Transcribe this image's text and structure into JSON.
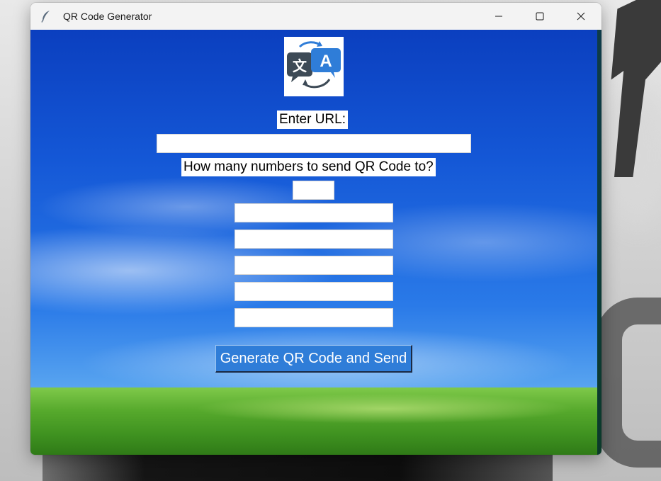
{
  "window": {
    "title": "QR Code Generator"
  },
  "icons": {
    "app": "feather-icon",
    "logo": "translate-icon",
    "minimize": "minimize-icon",
    "maximize": "maximize-icon",
    "close": "close-icon"
  },
  "logo": {
    "left_glyph": "文",
    "right_glyph": "A"
  },
  "form": {
    "url_label": "Enter URL:",
    "url_value": "",
    "count_label": "How many numbers to send QR Code to?",
    "count_value": "",
    "phone_values": [
      "",
      "",
      "",
      "",
      ""
    ],
    "submit_label": "Generate QR Code and Send"
  },
  "colors": {
    "sky_top": "#0b3fbf",
    "sky_bottom": "#a9d4f7",
    "grass": "#56a92c",
    "button_bg": "#2f7dd8",
    "button_text": "#ffffff"
  }
}
